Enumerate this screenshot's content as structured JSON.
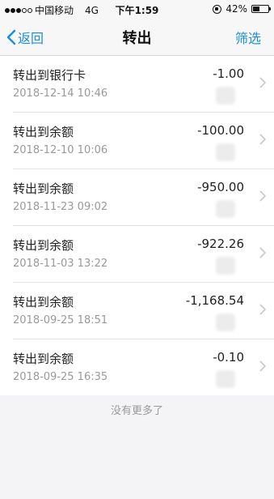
{
  "status_bar": {
    "carrier": "中国移动",
    "network": "4G",
    "time": "下午1:59",
    "battery": "42%",
    "battery_level": 0.42
  },
  "nav": {
    "back_label": "返回",
    "title": "转出",
    "filter_label": "筛选"
  },
  "records": [
    {
      "title": "转出到银行卡",
      "time": "2018-12-14 10:46",
      "amount": "-1.00"
    },
    {
      "title": "转出到余额",
      "time": "2018-12-10 10:06",
      "amount": "-100.00"
    },
    {
      "title": "转出到余额",
      "time": "2018-11-23 09:02",
      "amount": "-950.00"
    },
    {
      "title": "转出到余额",
      "time": "2018-11-03 13:22",
      "amount": "-922.26"
    },
    {
      "title": "转出到余额",
      "time": "2018-09-25 18:51",
      "amount": "-1,168.54"
    },
    {
      "title": "转出到余额",
      "time": "2018-09-25 16:35",
      "amount": "-0.10"
    }
  ],
  "footer": {
    "no_more_text": "没有更多了"
  },
  "colors": {
    "accent": "#1a8de0",
    "background": "#f4f4f6"
  }
}
